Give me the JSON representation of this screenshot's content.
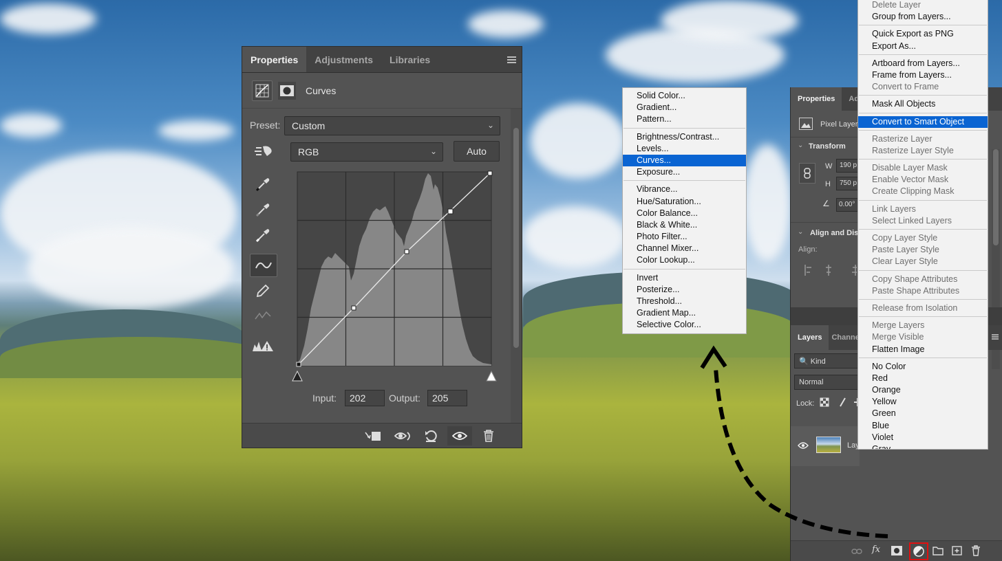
{
  "properties_panel": {
    "tabs": [
      "Properties",
      "Adjustments",
      "Libraries"
    ],
    "title": "Curves",
    "preset_label": "Preset:",
    "preset_value": "Custom",
    "channel_value": "RGB",
    "auto_label": "Auto",
    "input_label": "Input:",
    "input_value": "202",
    "output_label": "Output:",
    "output_value": "205"
  },
  "adjustment_menu": {
    "groups": [
      [
        "Solid Color...",
        "Gradient...",
        "Pattern..."
      ],
      [
        "Brightness/Contrast...",
        "Levels...",
        "Curves...",
        "Exposure..."
      ],
      [
        "Vibrance...",
        "Hue/Saturation...",
        "Color Balance...",
        "Black & White...",
        "Photo Filter...",
        "Channel Mixer...",
        "Color Lookup..."
      ],
      [
        "Invert",
        "Posterize...",
        "Threshold...",
        "Gradient Map...",
        "Selective Color..."
      ]
    ],
    "highlighted": "Curves..."
  },
  "context_menu": {
    "groups": [
      [
        "Delete Layer",
        "Group from Layers..."
      ],
      [
        "Quick Export as PNG",
        "Export As..."
      ],
      [
        "Artboard from Layers...",
        "Frame from Layers...",
        "Convert to Frame"
      ],
      [
        "Mask All Objects"
      ],
      [
        "Convert to Smart Object"
      ],
      [
        "Rasterize Layer",
        "Rasterize Layer Style"
      ],
      [
        "Disable Layer Mask",
        "Enable Vector Mask",
        "Create Clipping Mask"
      ],
      [
        "Link Layers",
        "Select Linked Layers"
      ],
      [
        "Copy Layer Style",
        "Paste Layer Style",
        "Clear Layer Style"
      ],
      [
        "Copy Shape Attributes",
        "Paste Shape Attributes"
      ],
      [
        "Release from Isolation"
      ],
      [
        "Merge Layers",
        "Merge Visible",
        "Flatten Image"
      ],
      [
        "No Color",
        "Red",
        "Orange",
        "Yellow",
        "Green",
        "Blue",
        "Violet",
        "Gray"
      ]
    ],
    "enabled": [
      "Group from Layers...",
      "Quick Export as PNG",
      "Export As...",
      "Artboard from Layers...",
      "Frame from Layers...",
      "Mask All Objects",
      "Convert to Smart Object",
      "Flatten Image",
      "No Color",
      "Red",
      "Orange",
      "Yellow",
      "Green",
      "Blue",
      "Violet",
      "Gray"
    ],
    "highlighted": "Convert to Smart Object"
  },
  "right_panel": {
    "tabs": [
      "Properties",
      "Ad"
    ],
    "pixel_layer_label": "Pixel Layer",
    "transform_label": "Transform",
    "w_label": "W",
    "w_value": "190 p",
    "h_label": "H",
    "h_value": "750 p",
    "angle_value": "0.00°",
    "align_label": "Align and Dis",
    "align_sub": "Align:",
    "layers_tabs": [
      "Layers",
      "Channe"
    ],
    "kind_label": "Kind",
    "blend_mode": "Normal",
    "lock_label": "Lock:",
    "layer_name": "Lay"
  },
  "colors": {
    "highlight": "#0a64d2",
    "panel_bg": "#535353",
    "red_outline": "#e01010"
  }
}
